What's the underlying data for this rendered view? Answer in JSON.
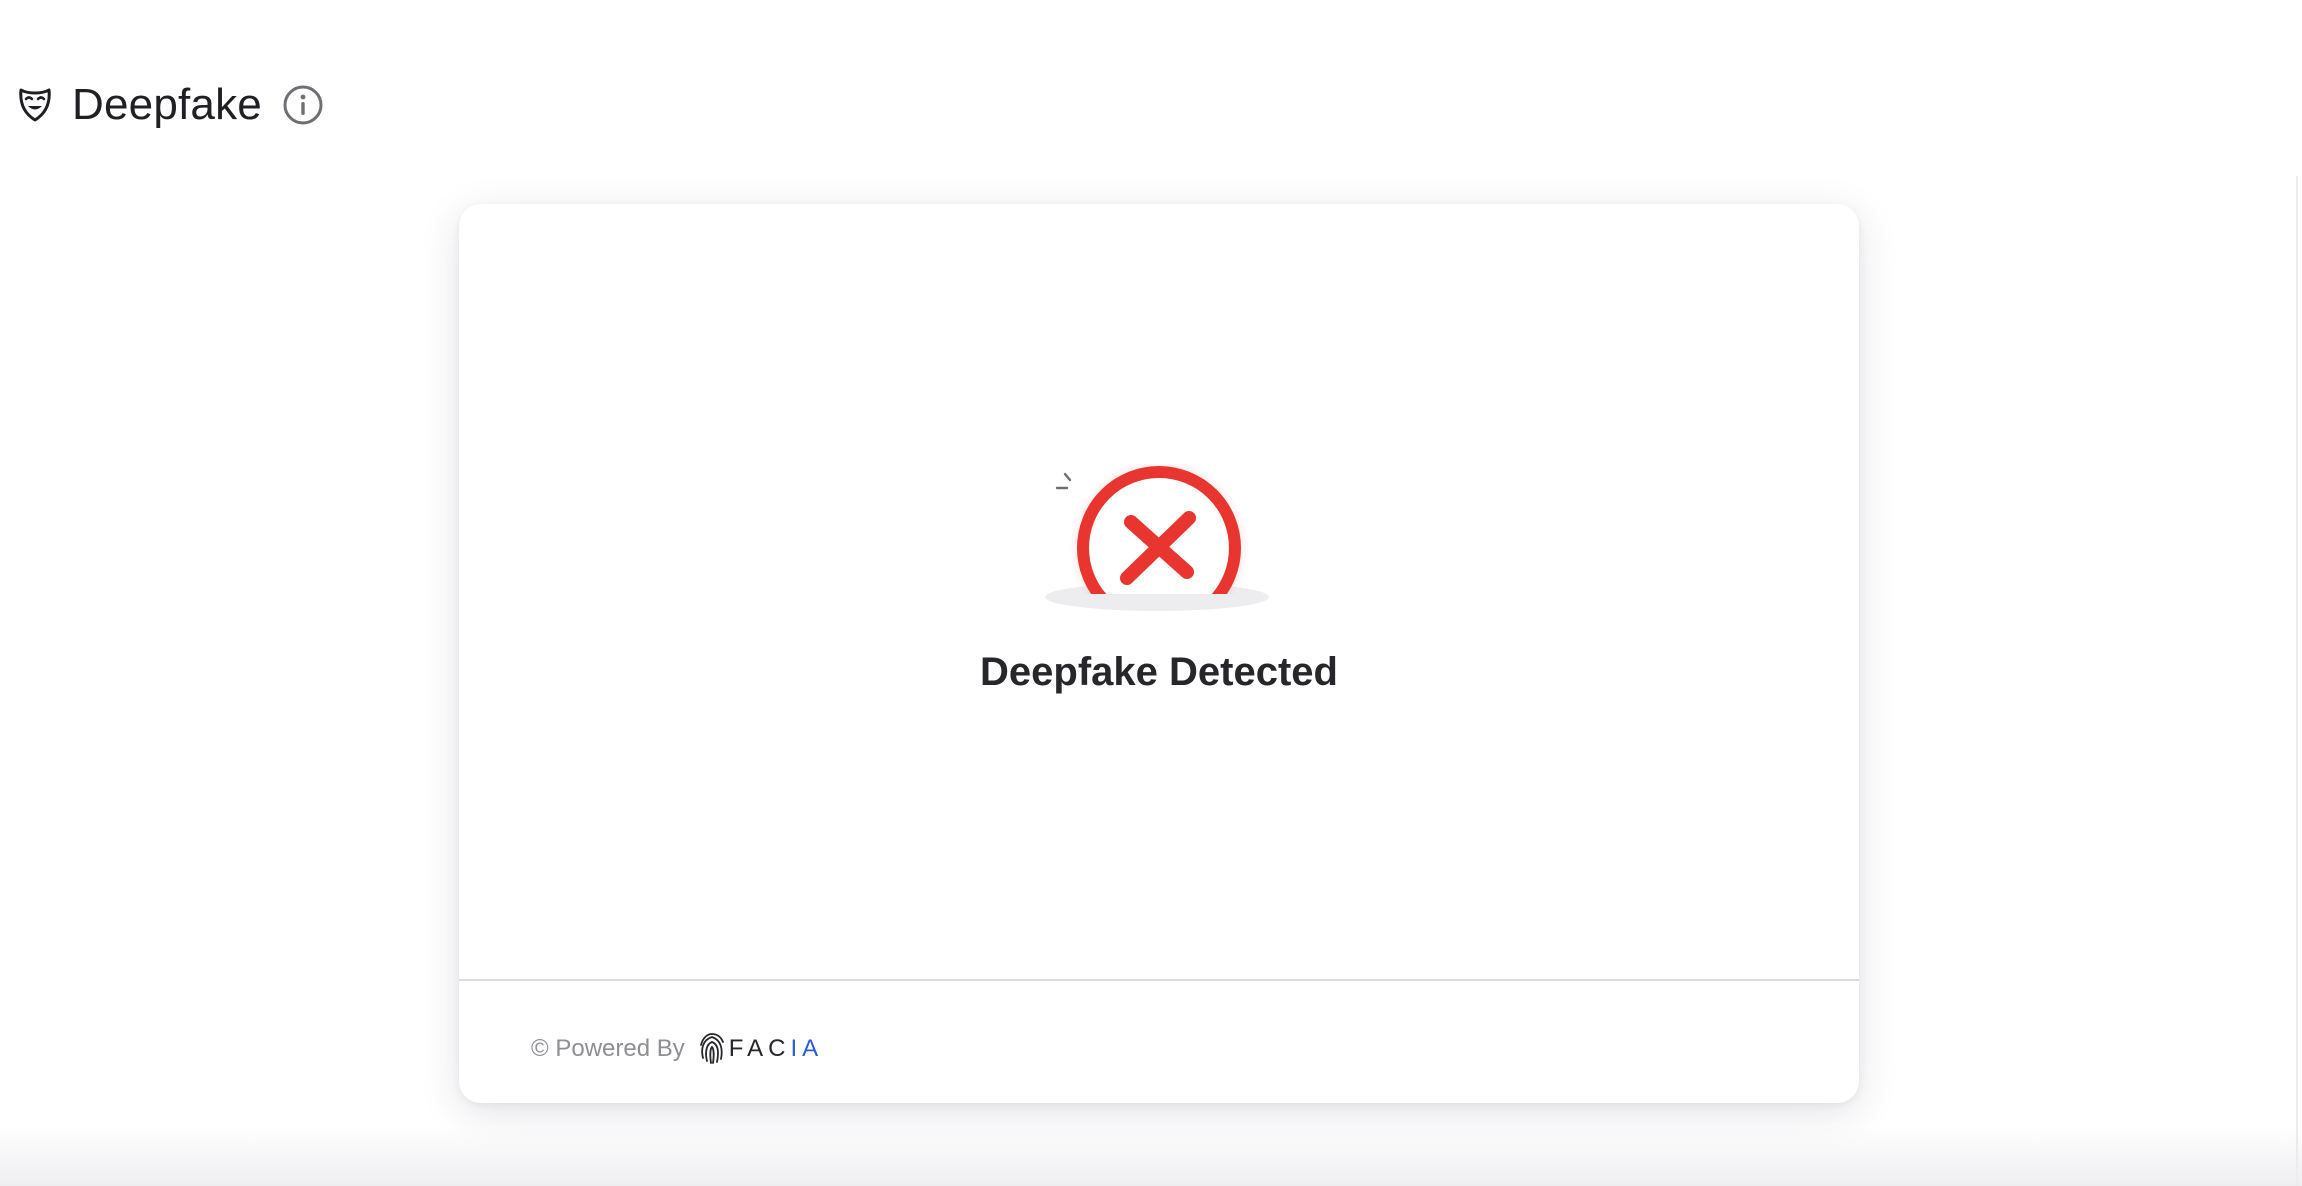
{
  "header": {
    "icon": "theater-mask-icon",
    "title": "Deepfake",
    "info_icon": "info-icon"
  },
  "result": {
    "icon": "red-x-circle-icon",
    "status": "Deepfake Detected",
    "accent_color": "#e8352f"
  },
  "footer": {
    "powered_by": "© Powered By",
    "brand_main": "FAC",
    "brand_accent": "IA",
    "brand_icon": "fingerprint-icon",
    "brand_accent_color": "#2d5bd6"
  }
}
